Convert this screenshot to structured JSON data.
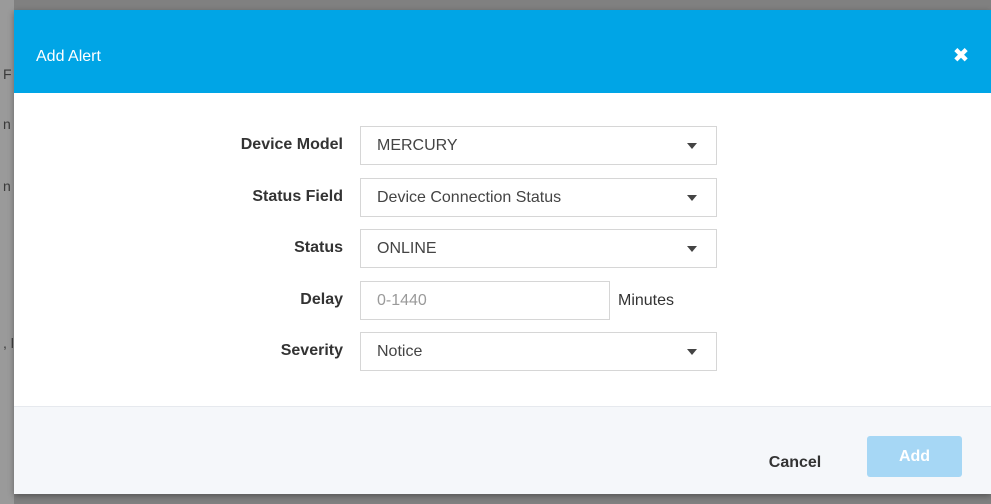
{
  "background": {
    "fragments": [
      "F",
      "n",
      "n",
      ", l"
    ]
  },
  "modal": {
    "title": "Add Alert",
    "close_glyph": "✖"
  },
  "form": {
    "device_model": {
      "label": "Device Model",
      "value": "MERCURY"
    },
    "status_field": {
      "label": "Status Field",
      "value": "Device Connection Status"
    },
    "status": {
      "label": "Status",
      "value": "ONLINE"
    },
    "delay": {
      "label": "Delay",
      "value": "",
      "placeholder": "0-1440",
      "unit": "Minutes"
    },
    "severity": {
      "label": "Severity",
      "value": "Notice"
    }
  },
  "footer": {
    "cancel_label": "Cancel",
    "add_label": "Add"
  },
  "colors": {
    "header": "#00a5e6",
    "add_button_disabled": "#a6d7f5",
    "overlay": "#808080"
  }
}
